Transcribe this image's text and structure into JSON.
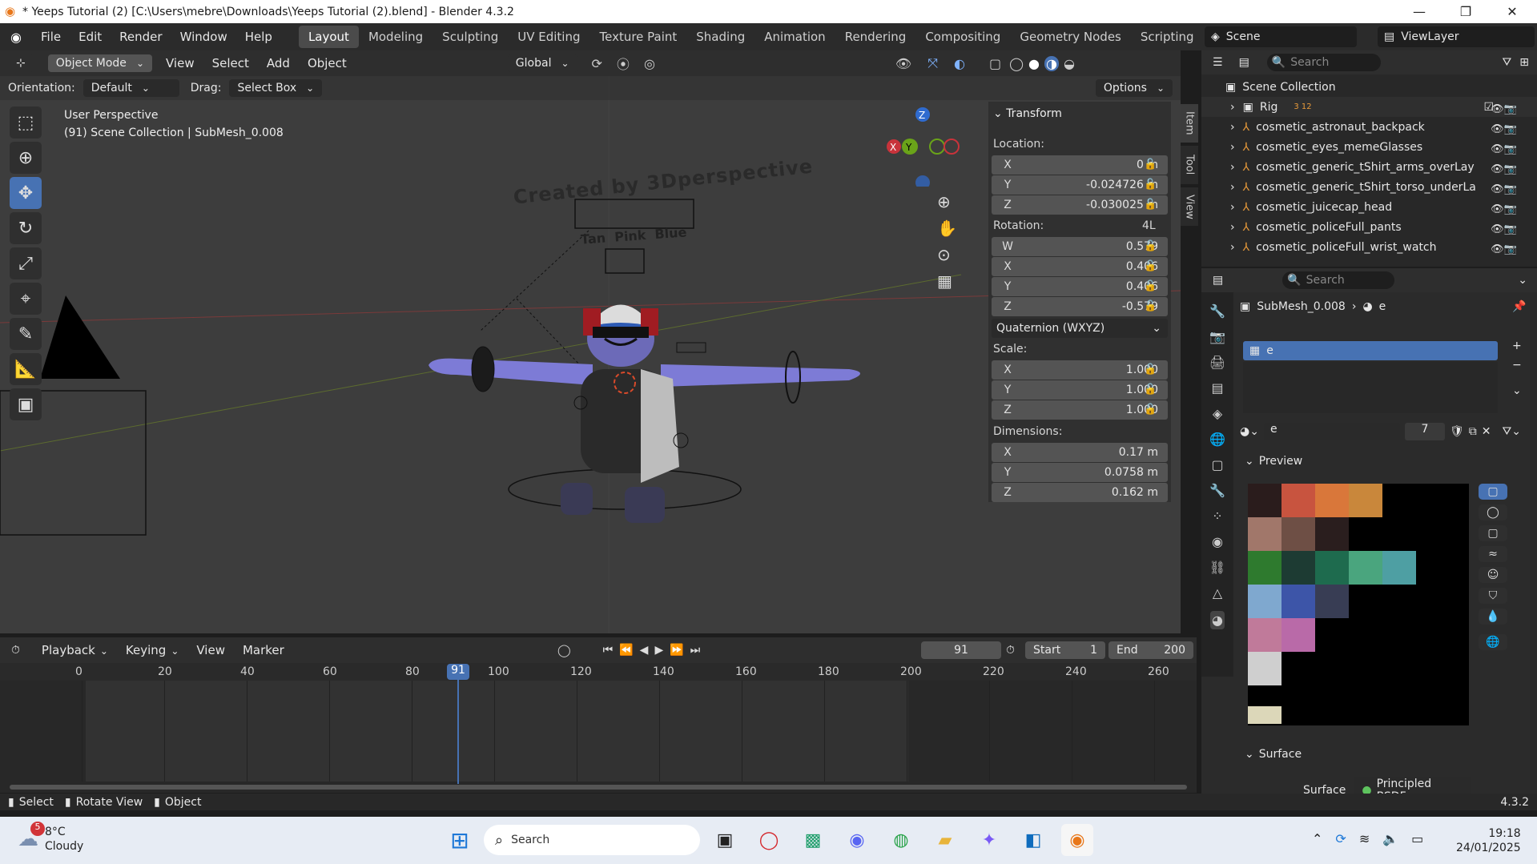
{
  "window": {
    "title": "* Yeeps Tutorial (2) [C:\\Users\\mebre\\Downloads\\Yeeps Tutorial (2).blend] - Blender 4.3.2"
  },
  "menu": [
    "File",
    "Edit",
    "Render",
    "Window",
    "Help"
  ],
  "workspaces": [
    "Layout",
    "Modeling",
    "Sculpting",
    "UV Editing",
    "Texture Paint",
    "Shading",
    "Animation",
    "Rendering",
    "Compositing",
    "Geometry Nodes",
    "Scripting"
  ],
  "scene": {
    "name": "Scene",
    "view_layer": "ViewLayer"
  },
  "viewport": {
    "mode": "Object Mode",
    "menus": [
      "View",
      "Select",
      "Add",
      "Object"
    ],
    "transform_orientation": "Global",
    "orientation_label": "Orientation:",
    "orientation_value": "Default",
    "drag_label": "Drag:",
    "drag_value": "Select Box",
    "options": "Options",
    "view_name": "User Perspective",
    "collection_info": "(91) Scene Collection | SubMesh_0.008",
    "scene_text_credit": "Created by 3Dperspective",
    "scene_text_colors": "Tan  Pink  Blue"
  },
  "npanel": {
    "title": "Transform",
    "location_label": "Location:",
    "location": [
      {
        "axis": "X",
        "value": "0 m"
      },
      {
        "axis": "Y",
        "value": "-0.024726 m"
      },
      {
        "axis": "Z",
        "value": "-0.030025 m"
      }
    ],
    "rotation_label": "Rotation:",
    "rotation_mode_badge": "4L",
    "rotation": [
      {
        "axis": "W",
        "value": "0.579"
      },
      {
        "axis": "X",
        "value": "0.406"
      },
      {
        "axis": "Y",
        "value": "0.406"
      },
      {
        "axis": "Z",
        "value": "-0.579"
      }
    ],
    "rotation_mode": "Quaternion (WXYZ)",
    "scale_label": "Scale:",
    "scale": [
      {
        "axis": "X",
        "value": "1.000"
      },
      {
        "axis": "Y",
        "value": "1.000"
      },
      {
        "axis": "Z",
        "value": "1.000"
      }
    ],
    "dimensions_label": "Dimensions:",
    "dimensions": [
      {
        "axis": "X",
        "value": "0.17 m"
      },
      {
        "axis": "Y",
        "value": "0.0758 m"
      },
      {
        "axis": "Z",
        "value": "0.162 m"
      }
    ],
    "tabs": [
      "Item",
      "Tool",
      "View"
    ]
  },
  "gizmo": {
    "x": "X",
    "y": "Y",
    "z": "Z"
  },
  "timeline": {
    "menus": [
      "Playback",
      "Keying",
      "View",
      "Marker"
    ],
    "current_frame": "91",
    "start_label": "Start",
    "start": "1",
    "end_label": "End",
    "end": "200",
    "ticks": [
      "0",
      "20",
      "40",
      "60",
      "80",
      "100",
      "120",
      "140",
      "160",
      "180",
      "200",
      "220",
      "240",
      "260"
    ]
  },
  "outliner": {
    "search_placeholder": "Search",
    "root": "Scene Collection",
    "items": [
      "Rig",
      "cosmetic_astronaut_backpack",
      "cosmetic_eyes_memeGlasses",
      "cosmetic_generic_tShirt_arms_overLay",
      "cosmetic_generic_tShirt_torso_underLa",
      "cosmetic_juicecap_head",
      "cosmetic_policeFull_pants",
      "cosmetic_policeFull_wrist_watch"
    ],
    "rig_badges": [
      "3",
      "12"
    ]
  },
  "properties": {
    "search_placeholder": "Search",
    "object": "SubMesh_0.008",
    "material": "e",
    "slot_name": "e",
    "material_name": "e",
    "users": "7",
    "preview_label": "Preview",
    "surface_section": "Surface",
    "surface_label": "Surface",
    "surface_value": "Principled BSDF"
  },
  "status": {
    "select": "Select",
    "rotate": "Rotate View",
    "object": "Object",
    "version": "4.3.2"
  },
  "taskbar": {
    "weather_temp": "8°C",
    "weather_desc": "Cloudy",
    "weather_badge": "5",
    "search": "Search",
    "time": "19:18",
    "date": "24/01/2025"
  },
  "palette": [
    [
      "#2a1c1c",
      "#c8543f",
      "#d9773a",
      "#c9873b"
    ],
    [
      "#a1776a",
      "#6e4f45",
      "#2a1e1e"
    ],
    [
      "#2e7a2e",
      "#1d3b33",
      "#1e6b4e",
      "#4aa57e",
      "#4e9fa3"
    ],
    [
      "#7fa8cf",
      "#3d55a8",
      "#383d54"
    ],
    [
      "#c07a9a",
      "#b96aa8"
    ],
    [
      "#cfcfcf"
    ]
  ]
}
